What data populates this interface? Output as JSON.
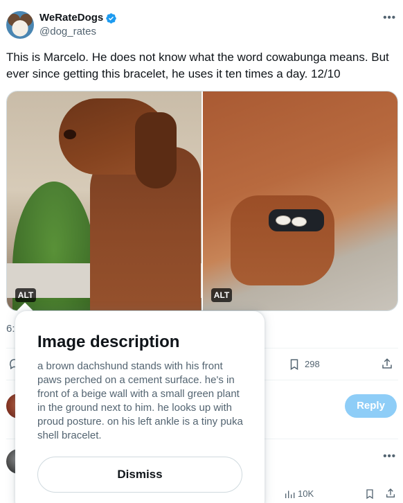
{
  "tweet": {
    "display_name": "WeRateDogs",
    "handle": "@dog_rates",
    "text": "This is Marcelo. He does not know what the word cowabunga means. But ever since getting this bracelet, he uses it ten times a day. 12/10",
    "media": {
      "alt_badges": [
        "ALT",
        "ALT"
      ]
    },
    "timestamp_partial": "6:",
    "bookmark_count": "298"
  },
  "reply": {
    "button_label": "Reply"
  },
  "next_tweet": {
    "views_count": "10K"
  },
  "image_description_popover": {
    "title": "Image description",
    "body": "a brown dachshund stands with his front paws perched on a cement surface. he's in front of a beige wall with a small green plant in the ground next to him. he looks up with proud posture. on his left ankle is a tiny puka shell bracelet.",
    "dismiss_label": "Dismiss"
  },
  "colors": {
    "accent": "#1d9bf0",
    "reply_button_disabled": "#8ecdf7",
    "text_primary": "#0f1419",
    "text_secondary": "#536471",
    "border": "#cfd9de"
  },
  "icons": [
    "verified-badge-icon",
    "more-icon",
    "reply-icon",
    "bookmark-icon",
    "share-icon",
    "views-icon"
  ]
}
